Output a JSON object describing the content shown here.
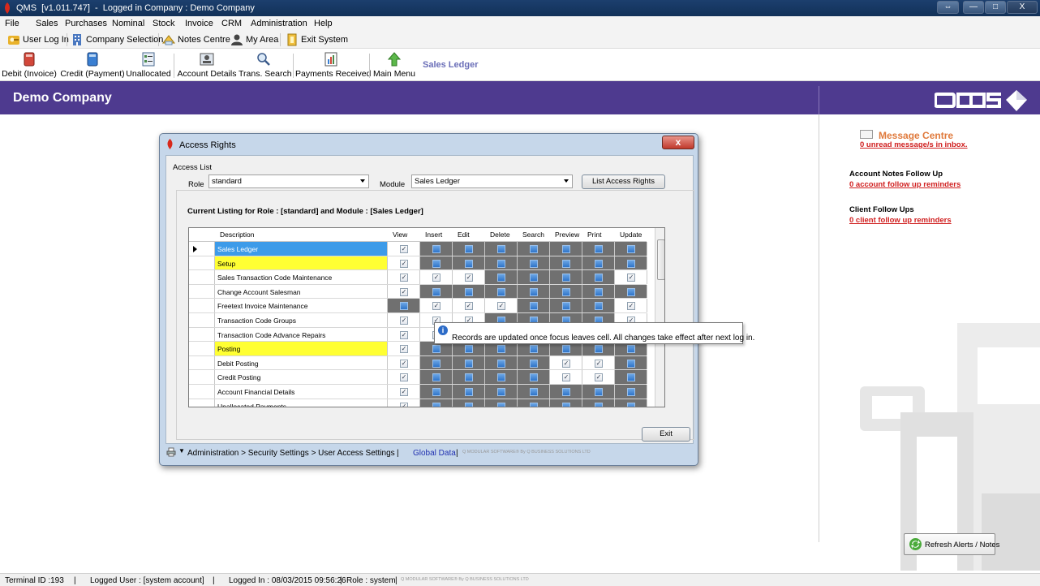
{
  "window": {
    "title": "QMS  [v1.011.747]  -  Logged in Company : Demo Company",
    "controls": [
      "—",
      "□",
      "X"
    ]
  },
  "menu": [
    "File",
    "Sales",
    "Purchases",
    "Nominal",
    "Stock",
    "Invoice",
    "CRM",
    "Administration",
    "Help"
  ],
  "quickbar": {
    "user_log_in": "User Log In",
    "company_selection": "Company Selection",
    "notes_centre": "Notes Centre",
    "my_area": "My Area",
    "exit_system": "Exit System"
  },
  "toolbar": {
    "debit_invoice": "Debit (Invoice)",
    "credit_payment": "Credit (Payment)",
    "unallocated": "Unallocated",
    "account_details": "Account Details",
    "trans_search": "Trans. Search",
    "payments_received": "Payments Received",
    "main_menu": "Main Menu",
    "section": "Sales Ledger"
  },
  "banner": {
    "company": "Demo Company",
    "logo_alt": "QMS"
  },
  "right_panel": {
    "message_centre_title": "Message Centre",
    "message_centre_link": "0 unread message/s in inbox.",
    "account_notes_title": "Account Notes Follow Up",
    "account_notes_link": "0 account follow up reminders",
    "client_follow_title": "Client Follow Ups",
    "client_follow_link": "0 client follow up reminders",
    "refresh_button": "Refresh Alerts / Notes"
  },
  "dialog": {
    "title": "Access Rights",
    "close": "x",
    "access_list": "Access List",
    "role_label": "Role",
    "role_value": "standard",
    "module_label": "Module",
    "module_value": "Sales Ledger",
    "list_button": "List Access Rights",
    "listing_title": "Current Listing for Role : [standard] and Module : [Sales Ledger]",
    "exit_button": "Exit",
    "tooltip": "Records are updated once focus leaves cell. All changes take effect after next log in.",
    "status_path": "Administration > Security Settings > User Access Settings",
    "status_sep": "|",
    "status_global": "Global Data",
    "status_company": "Q MODULAR SOFTWARE® By Q BUSINESS SOLUTIONS LTD"
  },
  "grid": {
    "columns": [
      "Description",
      "View",
      "Insert",
      "Edit",
      "Delete",
      "Search",
      "Preview",
      "Print",
      "Update"
    ],
    "rows": [
      {
        "desc": "Sales Ledger",
        "hl": "blue",
        "current": true,
        "cells": [
          "c",
          "b",
          "b",
          "b",
          "b",
          "b",
          "b",
          "b"
        ]
      },
      {
        "desc": "Setup",
        "hl": "yellow",
        "cells": [
          "c",
          "b",
          "b",
          "b",
          "b",
          "b",
          "b",
          "b"
        ]
      },
      {
        "desc": "Sales Transaction Code Maintenance",
        "hl": "",
        "cells": [
          "c",
          "c",
          "c",
          "b",
          "b",
          "b",
          "b",
          "c"
        ]
      },
      {
        "desc": "Change Account Salesman",
        "hl": "",
        "cells": [
          "c",
          "b",
          "b",
          "b",
          "b",
          "b",
          "b",
          "b"
        ]
      },
      {
        "desc": "Freetext Invoice Maintenance",
        "hl": "",
        "cells": [
          "b",
          "c",
          "c",
          "c",
          "b",
          "b",
          "b",
          "c"
        ]
      },
      {
        "desc": "Transaction Code Groups",
        "hl": "",
        "cells": [
          "c",
          "c",
          "c",
          "b",
          "b",
          "b",
          "b",
          "c"
        ]
      },
      {
        "desc": "Transaction Code Advance Repairs",
        "hl": "",
        "cells": [
          "c",
          "c",
          "b",
          "b",
          "b",
          "b",
          "b",
          "b"
        ]
      },
      {
        "desc": "Posting",
        "hl": "yellow",
        "cells": [
          "c",
          "b",
          "b",
          "b",
          "b",
          "b",
          "b",
          "b"
        ]
      },
      {
        "desc": "Debit Posting",
        "hl": "",
        "cells": [
          "c",
          "b",
          "b",
          "b",
          "b",
          "c",
          "c",
          "b"
        ]
      },
      {
        "desc": "Credit Posting",
        "hl": "",
        "cells": [
          "c",
          "b",
          "b",
          "b",
          "b",
          "c",
          "c",
          "b"
        ]
      },
      {
        "desc": "Account Financial Details",
        "hl": "",
        "cells": [
          "c",
          "b",
          "b",
          "b",
          "b",
          "b",
          "b",
          "b"
        ]
      },
      {
        "desc": "Unallocated Payments",
        "hl": "",
        "cells": [
          "c",
          "b",
          "b",
          "b",
          "b",
          "b",
          "b",
          "b"
        ]
      }
    ]
  },
  "statusbar": {
    "terminal": "Terminal ID :193",
    "user": "Logged User : [system account]",
    "logged_in": "Logged In : 08/03/2015 09:56:26",
    "role": "Role : system",
    "sep": "|",
    "company": "Q MODULAR SOFTWARE® By Q BUSINESS SOLUTIONS LTD"
  },
  "colors": {
    "banner": "#4e3a8f",
    "accent_link": "#d02020",
    "message_title": "#e07a3c",
    "row_selected": "#3d9be9",
    "row_group": "#ffff33",
    "cell_disabled": "#707070"
  }
}
